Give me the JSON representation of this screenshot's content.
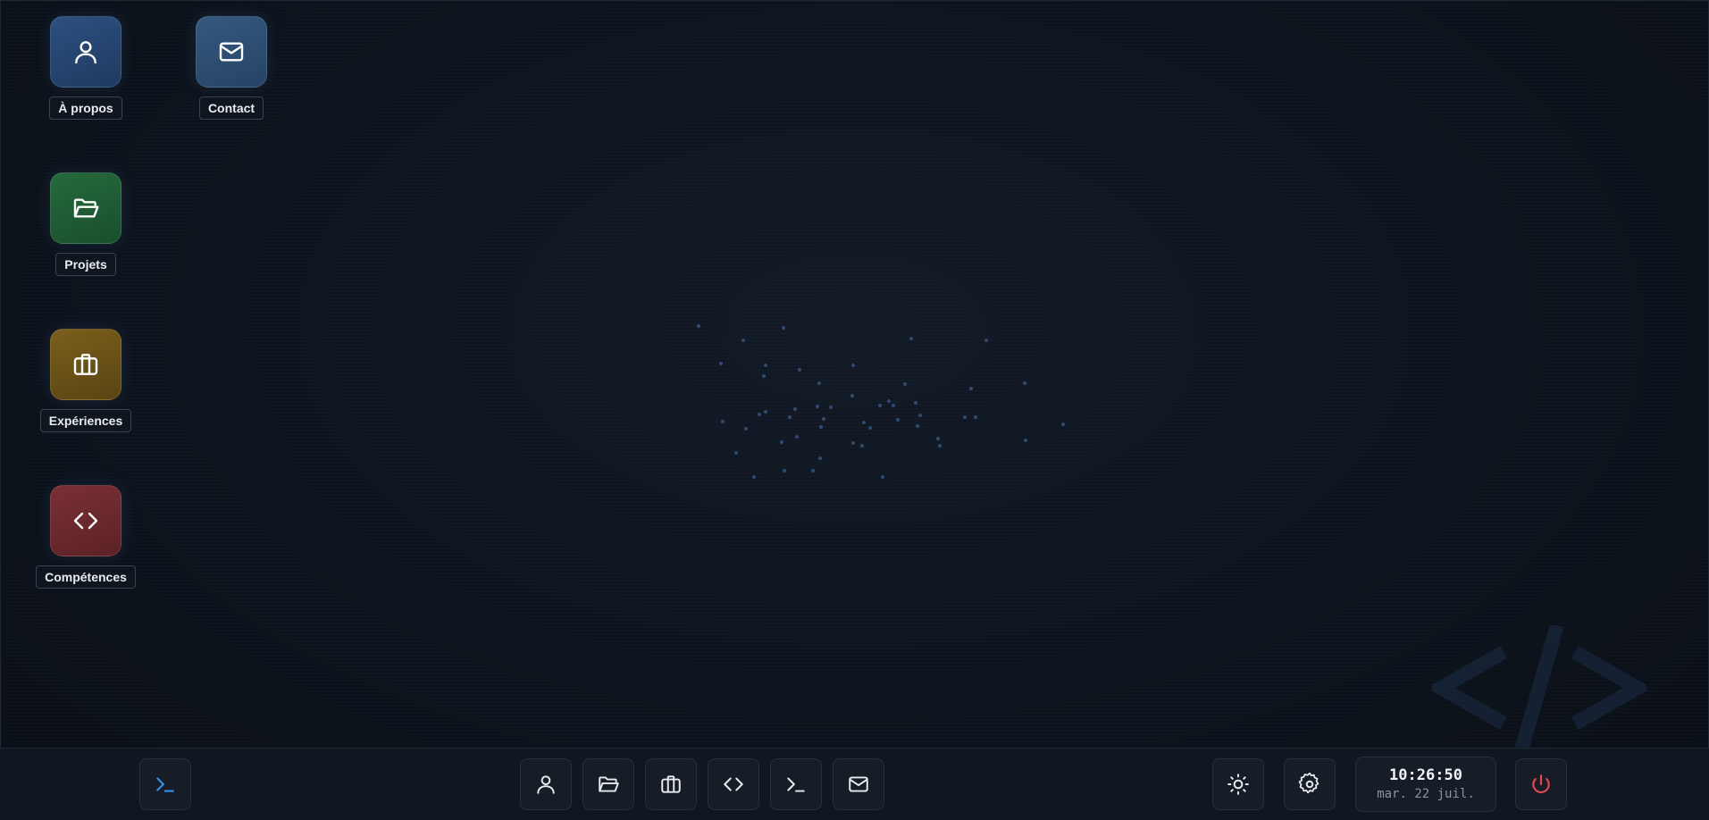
{
  "desktop": {
    "icons": [
      {
        "label": "À propos",
        "icon": "user-icon",
        "color": "#27466f"
      },
      {
        "label": "Contact",
        "icon": "mail-icon",
        "color": "#2d4a6c"
      },
      {
        "label": "Projets",
        "icon": "folder-open-icon",
        "color": "#1f5a33"
      },
      {
        "label": "Expériences",
        "icon": "briefcase-icon",
        "color": "#6b5217"
      },
      {
        "label": "Compétences",
        "icon": "code-icon",
        "color": "#6e2b2e"
      }
    ]
  },
  "taskbar": {
    "start": {
      "icon": "terminal-icon",
      "accent": "#3b8ee8"
    },
    "apps": [
      {
        "icon": "user-icon"
      },
      {
        "icon": "folder-open-icon"
      },
      {
        "icon": "briefcase-icon"
      },
      {
        "icon": "code-icon"
      },
      {
        "icon": "terminal-icon"
      },
      {
        "icon": "mail-icon"
      }
    ],
    "tray": [
      {
        "icon": "sun-icon"
      },
      {
        "icon": "gear-icon"
      }
    ],
    "clock": {
      "time": "10:26:50",
      "date": "mar. 22 juil."
    },
    "power": {
      "icon": "power-icon",
      "color": "#e5484d"
    }
  }
}
